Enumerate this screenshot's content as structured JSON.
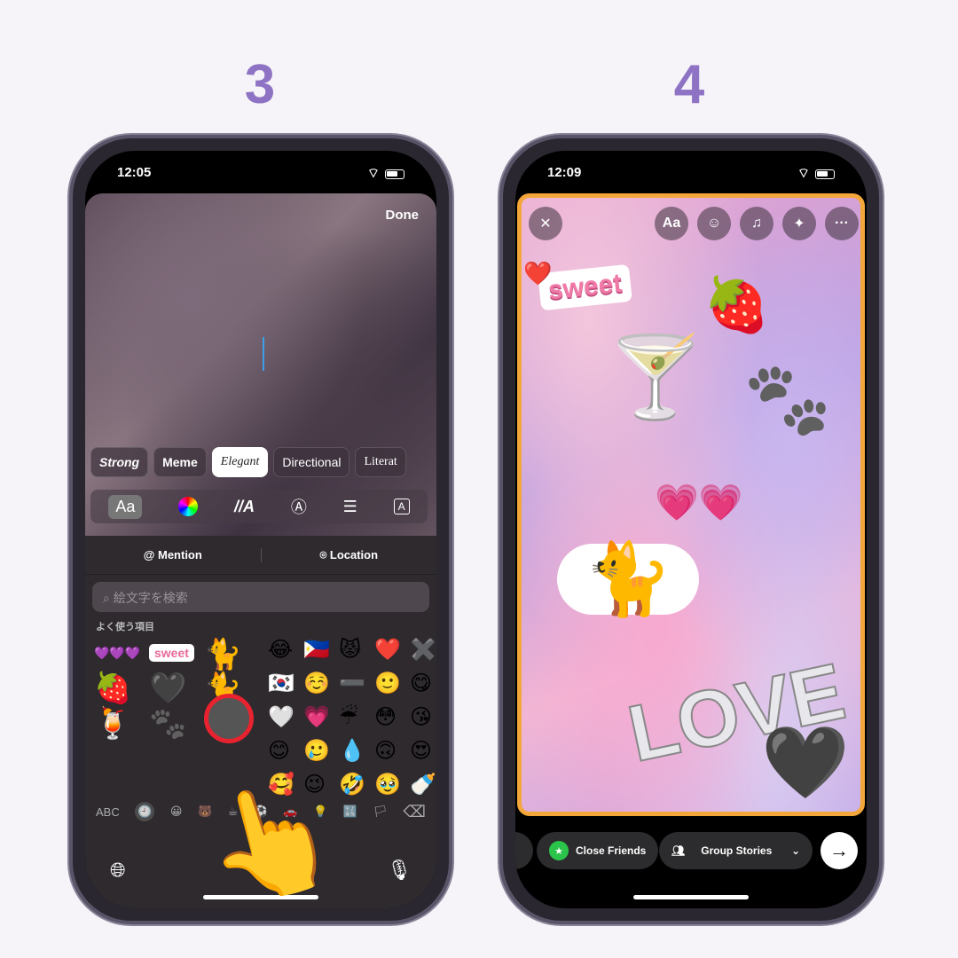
{
  "steps": [
    "3",
    "4"
  ],
  "phone3": {
    "time": "12:05",
    "done": "Done",
    "styles": [
      "Strong",
      "Meme",
      "Elegant",
      "Directional",
      "Literat"
    ],
    "tools": [
      "Aa",
      "color-wheel-icon",
      "//A",
      "outline-A-icon",
      "align-icon",
      "boxed-A-icon"
    ],
    "mention": "Mention",
    "location": "Location",
    "search_placeholder": "絵文字を検索",
    "frequent_label": "よく使う項目",
    "emojis": [
      [
        "😂",
        "🇵🇭",
        "😾",
        "❤️",
        "✖️"
      ],
      [
        "🇰🇷",
        "☺️",
        "➖",
        "🙂",
        "😋"
      ],
      [
        "🤍",
        "💗",
        "☔",
        "😳",
        "😘"
      ],
      [
        "😊",
        "🥲",
        "💧",
        "🙃",
        "😍"
      ],
      [
        "🥰",
        "😉",
        "🤣",
        "🥹",
        "🍼"
      ]
    ],
    "stickers": [
      "💜💜💜",
      "sweet",
      "🐈",
      "🍓",
      "🖤",
      "🐈",
      "🍹",
      "🐾"
    ],
    "abc": "ABC",
    "categories": [
      "🕘",
      "😀",
      "🐻",
      "☕",
      "⚽",
      "🚗",
      "💡",
      "🔣",
      "🏳"
    ]
  },
  "phone4": {
    "time": "12:09",
    "top_icons": [
      "close-icon",
      "text-icon",
      "sticker-icon",
      "music-icon",
      "sparkle-icon",
      "more-icon"
    ],
    "aa": "Aa",
    "stickers": {
      "sweet": "sweet",
      "love": "LOVE"
    },
    "close_friends": "Close Friends",
    "group_stories": "Group Stories",
    "accent": "#f3a73b",
    "green": "#2bc44a"
  }
}
